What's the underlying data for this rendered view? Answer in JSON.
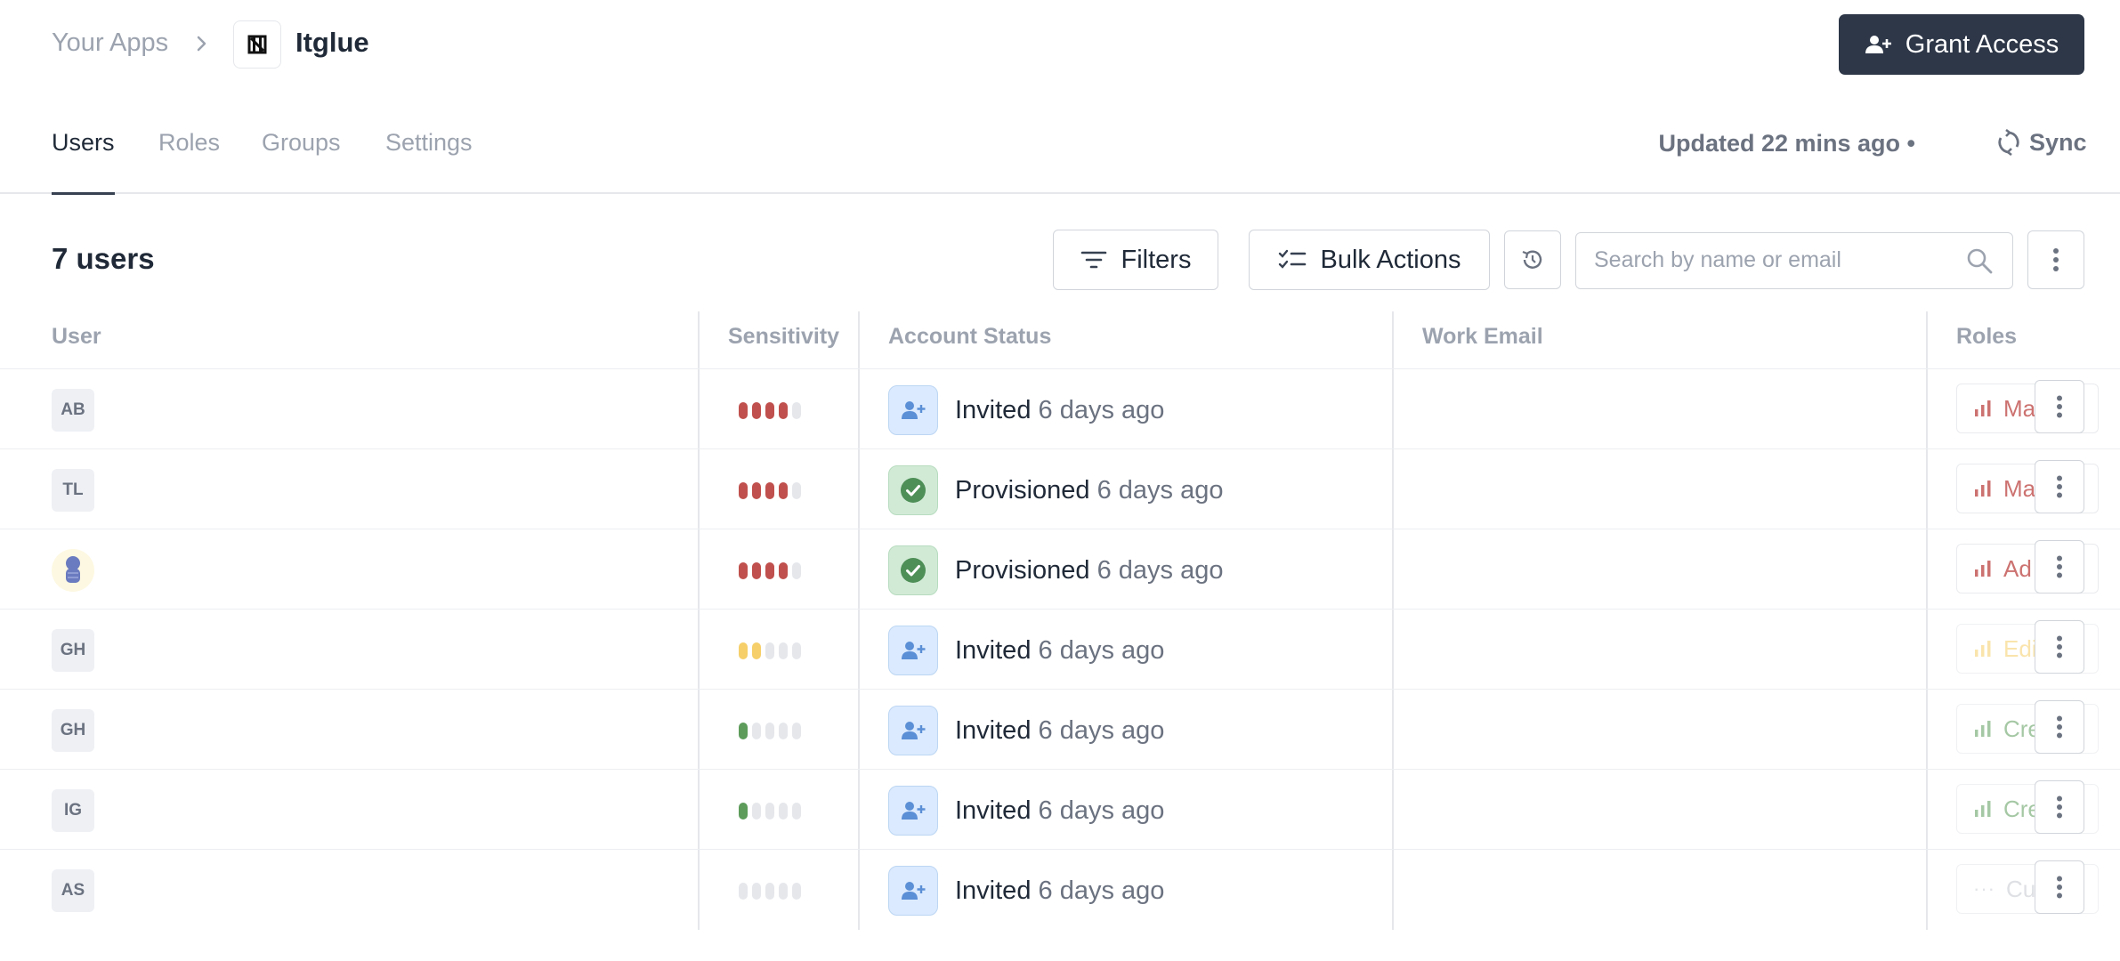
{
  "breadcrumb": {
    "root": "Your Apps",
    "app": "Itglue"
  },
  "grant_access_label": "Grant Access",
  "tabs": [
    {
      "label": "Users",
      "active": true
    },
    {
      "label": "Roles",
      "active": false
    },
    {
      "label": "Groups",
      "active": false
    },
    {
      "label": "Settings",
      "active": false
    }
  ],
  "updated_text": "Updated 22 mins ago •",
  "sync_label": "Sync",
  "user_count": "7 users",
  "toolbar": {
    "filters_label": "Filters",
    "bulk_actions_label": "Bulk Actions",
    "search_placeholder": "Search by name or email"
  },
  "columns": [
    "User",
    "Sensitivity",
    "Account Status",
    "Work Email",
    "Roles"
  ],
  "colors": {
    "high": "#c0504d",
    "medium": "#f6cf6a",
    "low": "#5d9c5b",
    "empty": "#e5e7eb"
  },
  "rows": [
    {
      "initials": "AB",
      "sensitivity": 4,
      "level": "high",
      "status": "Invited",
      "time": "6 days ago",
      "role": "Ma"
    },
    {
      "initials": "TL",
      "sensitivity": 4,
      "level": "high",
      "status": "Provisioned",
      "time": "6 days ago",
      "role": "Ma"
    },
    {
      "initials": "",
      "avatar_image": true,
      "sensitivity": 4,
      "level": "high",
      "status": "Provisioned",
      "time": "6 days ago",
      "role": "Ad"
    },
    {
      "initials": "GH",
      "sensitivity": 2,
      "level": "medium",
      "status": "Invited",
      "time": "6 days ago",
      "role": "Edi"
    },
    {
      "initials": "GH",
      "sensitivity": 1,
      "level": "low",
      "status": "Invited",
      "time": "6 days ago",
      "role": "Cre"
    },
    {
      "initials": "IG",
      "sensitivity": 1,
      "level": "low",
      "status": "Invited",
      "time": "6 days ago",
      "role": "Cre"
    },
    {
      "initials": "AS",
      "sensitivity": 0,
      "level": "empty",
      "status": "Invited",
      "time": "6 days ago",
      "role": "Cu"
    }
  ]
}
